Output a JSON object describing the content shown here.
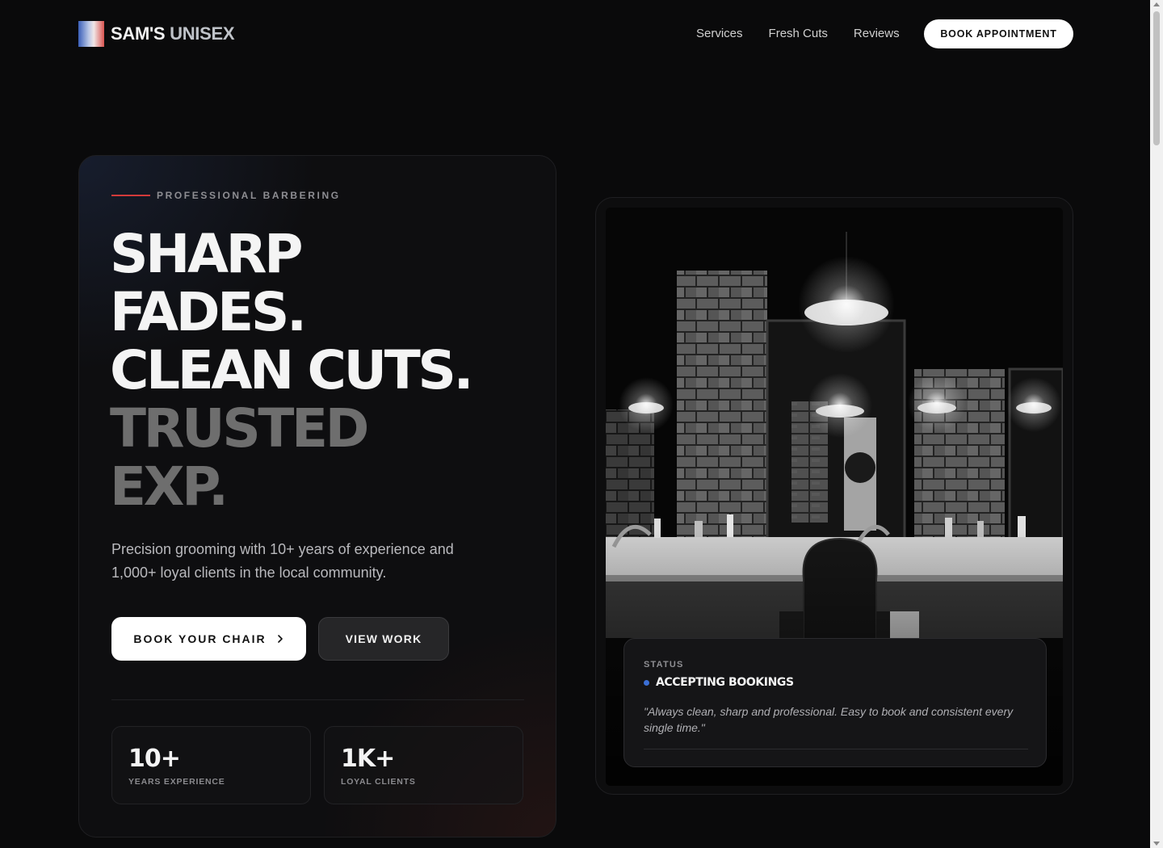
{
  "brand": {
    "name_part1": "SAM'S",
    "name_part2": "UNISEX"
  },
  "nav": {
    "links": [
      "Services",
      "Fresh Cuts",
      "Reviews"
    ],
    "cta": "BOOK APPOINTMENT"
  },
  "hero": {
    "eyebrow": "PROFESSIONAL BARBERING",
    "headline_lines": [
      {
        "text": "SHARP",
        "tone": "white"
      },
      {
        "text": "FADES.",
        "tone": "white"
      },
      {
        "text": "CLEAN CUTS.",
        "tone": "white"
      },
      {
        "text": "TRUSTED",
        "tone": "gray"
      },
      {
        "text": "EXP.",
        "tone": "gray"
      }
    ],
    "lead": "Precision grooming with 10+ years of experience and 1,000+ loyal clients in the local community.",
    "primary_button": "BOOK YOUR CHAIR",
    "secondary_button": "VIEW WORK",
    "stats": [
      {
        "value": "10+",
        "label": "YEARS EXPERIENCE"
      },
      {
        "value": "1K+",
        "label": "LOYAL CLIENTS"
      }
    ]
  },
  "status_card": {
    "label": "STATUS",
    "status": "ACCEPTING BOOKINGS",
    "quote": "\"Always clean, sharp and professional. Easy to book and consistent every single time.\""
  },
  "colors": {
    "background": "#0a0a0b",
    "accent_red": "#d33a3a",
    "status_blue": "#3b6fd6",
    "button_white": "#ffffff"
  }
}
